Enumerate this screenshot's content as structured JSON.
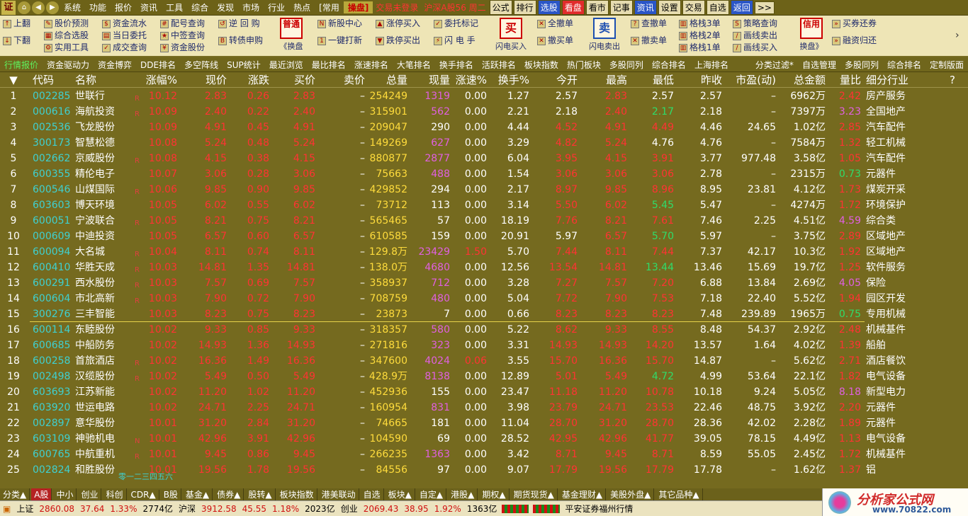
{
  "menubar": {
    "logo": "证",
    "items": [
      "系统",
      "功能",
      "报价",
      "资讯",
      "工具",
      "综合",
      "发现",
      "市场",
      "行业",
      "热点",
      "[常用"
    ],
    "hot_item": "操盘]",
    "status_login": "交易未登录",
    "status_index": "沪深A股56 周二",
    "right_buttons": [
      "公式",
      "排行",
      "选股",
      "看盘",
      "看市",
      "记事",
      "资讯",
      "设置",
      "交易",
      "自选",
      "返回",
      ">>"
    ]
  },
  "toolbar": {
    "col1": [
      "上翻",
      "下翻"
    ],
    "col2": [
      "股价预测",
      "综合选股",
      "实用工具"
    ],
    "col3": [
      "资金流水",
      "当日委托",
      "成交查询"
    ],
    "col4": [
      "配号查询",
      "中签查询",
      "资金股份"
    ],
    "col5": [
      "逆 回 购",
      "转债申购"
    ],
    "big_normal": {
      "top": "普通",
      "bottom": "《换盘"
    },
    "col6": [
      "新股中心",
      "一键打新"
    ],
    "col7": [
      "涨停买入",
      "跌停买出"
    ],
    "col8": [
      "委托标记",
      "闪 电 手"
    ],
    "big_buy": {
      "top": "买",
      "bottom": "闪电买入"
    },
    "col9": [
      "全撤单",
      "撤买单"
    ],
    "big_sell": {
      "top": "卖",
      "bottom": "闪电卖出"
    },
    "col10": [
      "查撤单",
      "撤卖单"
    ],
    "col11": [
      "格栈3单",
      "格栈2单",
      "格栈1单"
    ],
    "col12": [
      "策略查询",
      "画线卖出",
      "画线买入"
    ],
    "big_credit": {
      "top": "信用",
      "bottom": "换盘》"
    },
    "col13": [
      "买券还券",
      "融资归还"
    ]
  },
  "tabs2": [
    "行情报价",
    "资金驱动力",
    "资金博弈",
    "DDE排名",
    "多空阵线",
    "SUP统计",
    "最近浏览",
    "最比排名",
    "涨速排名",
    "大笔排名",
    "换手排名",
    "活跃排名",
    "板块指数",
    "热门板块",
    "多股同列",
    "综合排名",
    "上海排名",
    "",
    "分类过滤*",
    "自选管理",
    "多股同列",
    "综合排名",
    "定制版面"
  ],
  "table": {
    "headers": [
      "▼",
      "代码",
      "名称",
      "涨幅%",
      "现价",
      "涨跌",
      "买价",
      "卖价",
      "总量",
      "现量",
      "涨速%",
      "换手%",
      "今开",
      "最高",
      "最低",
      "昨收",
      "市盈(动)",
      "总金额",
      "量比",
      "细分行业"
    ],
    "rows": [
      {
        "seq": "1",
        "code": "002285",
        "name": "世联行",
        "mark": "R",
        "pct": "10.12",
        "price": "2.83",
        "chg": "0.26",
        "bid": "2.83",
        "ask": "–",
        "vol": "254249",
        "cur": "1319",
        "spd": "0.00",
        "turn": "1.27",
        "open": "2.57",
        "high": "2.83",
        "low": "2.57",
        "prev": "2.57",
        "pe": "–",
        "amt": "6962万",
        "ratio": "2.42",
        "ind": "房产服务"
      },
      {
        "seq": "2",
        "code": "000616",
        "name": "海航投资",
        "mark": "R",
        "pct": "10.09",
        "price": "2.40",
        "chg": "0.22",
        "bid": "2.40",
        "ask": "–",
        "vol": "315901",
        "cur": "562",
        "spd": "0.00",
        "turn": "2.21",
        "open": "2.18",
        "high": "2.40",
        "low": "2.17",
        "prev": "2.18",
        "pe": "–",
        "amt": "7397万",
        "ratio": "3.23",
        "ind": "全国地产"
      },
      {
        "seq": "3",
        "code": "002536",
        "name": "飞龙股份",
        "mark": "",
        "pct": "10.09",
        "price": "4.91",
        "chg": "0.45",
        "bid": "4.91",
        "ask": "–",
        "vol": "209047",
        "cur": "290",
        "spd": "0.00",
        "turn": "4.44",
        "open": "4.52",
        "high": "4.91",
        "low": "4.49",
        "prev": "4.46",
        "pe": "24.65",
        "amt": "1.02亿",
        "ratio": "2.85",
        "ind": "汽车配件"
      },
      {
        "seq": "4",
        "code": "300173",
        "name": "智慧松德",
        "mark": "",
        "pct": "10.08",
        "price": "5.24",
        "chg": "0.48",
        "bid": "5.24",
        "ask": "–",
        "vol": "149269",
        "cur": "627",
        "spd": "0.00",
        "turn": "3.29",
        "open": "4.82",
        "high": "5.24",
        "low": "4.76",
        "prev": "4.76",
        "pe": "–",
        "amt": "7584万",
        "ratio": "1.32",
        "ind": "轻工机械"
      },
      {
        "seq": "5",
        "code": "002662",
        "name": "京威股份",
        "mark": "R",
        "pct": "10.08",
        "price": "4.15",
        "chg": "0.38",
        "bid": "4.15",
        "ask": "–",
        "vol": "880877",
        "cur": "2877",
        "spd": "0.00",
        "turn": "6.04",
        "open": "3.95",
        "high": "4.15",
        "low": "3.91",
        "prev": "3.77",
        "pe": "977.48",
        "amt": "3.58亿",
        "ratio": "1.05",
        "ind": "汽车配件"
      },
      {
        "seq": "6",
        "code": "600355",
        "name": "精伦电子",
        "mark": "",
        "pct": "10.07",
        "price": "3.06",
        "chg": "0.28",
        "bid": "3.06",
        "ask": "–",
        "vol": "75663",
        "cur": "488",
        "spd": "0.00",
        "turn": "1.54",
        "open": "3.06",
        "high": "3.06",
        "low": "3.06",
        "prev": "2.78",
        "pe": "–",
        "amt": "2315万",
        "ratio": "0.73",
        "ind": "元器件"
      },
      {
        "seq": "7",
        "code": "600546",
        "name": "山煤国际",
        "mark": "R",
        "pct": "10.06",
        "price": "9.85",
        "chg": "0.90",
        "bid": "9.85",
        "ask": "–",
        "vol": "429852",
        "cur": "294",
        "spd": "0.00",
        "turn": "2.17",
        "open": "8.97",
        "high": "9.85",
        "low": "8.96",
        "prev": "8.95",
        "pe": "23.81",
        "amt": "4.12亿",
        "ratio": "1.73",
        "ind": "煤炭开采"
      },
      {
        "seq": "8",
        "code": "603603",
        "name": "博天环境",
        "mark": "",
        "pct": "10.05",
        "price": "6.02",
        "chg": "0.55",
        "bid": "6.02",
        "ask": "–",
        "vol": "73712",
        "cur": "113",
        "spd": "0.00",
        "turn": "3.14",
        "open": "5.50",
        "high": "6.02",
        "low": "5.45",
        "prev": "5.47",
        "pe": "–",
        "amt": "4274万",
        "ratio": "1.72",
        "ind": "环境保护"
      },
      {
        "seq": "9",
        "code": "600051",
        "name": "宁波联合",
        "mark": "R",
        "pct": "10.05",
        "price": "8.21",
        "chg": "0.75",
        "bid": "8.21",
        "ask": "–",
        "vol": "565465",
        "cur": "57",
        "spd": "0.00",
        "turn": "18.19",
        "open": "7.76",
        "high": "8.21",
        "low": "7.61",
        "prev": "7.46",
        "pe": "2.25",
        "amt": "4.51亿",
        "ratio": "4.59",
        "ind": "综合类"
      },
      {
        "seq": "10",
        "code": "000609",
        "name": "中迪投资",
        "mark": "",
        "pct": "10.05",
        "price": "6.57",
        "chg": "0.60",
        "bid": "6.57",
        "ask": "–",
        "vol": "610585",
        "cur": "159",
        "spd": "0.00",
        "turn": "20.91",
        "open": "5.97",
        "high": "6.57",
        "low": "5.70",
        "prev": "5.97",
        "pe": "–",
        "amt": "3.75亿",
        "ratio": "2.89",
        "ind": "区域地产"
      },
      {
        "seq": "11",
        "code": "600094",
        "name": "大名城",
        "mark": "R",
        "pct": "10.04",
        "price": "8.11",
        "chg": "0.74",
        "bid": "8.11",
        "ask": "–",
        "vol": "129.8万",
        "cur": "23429",
        "spd": "1.50",
        "turn": "5.70",
        "open": "7.44",
        "high": "8.11",
        "low": "7.44",
        "prev": "7.37",
        "pe": "42.17",
        "amt": "10.3亿",
        "ratio": "1.92",
        "ind": "区域地产"
      },
      {
        "seq": "12",
        "code": "600410",
        "name": "华胜天成",
        "mark": "R",
        "pct": "10.03",
        "price": "14.81",
        "chg": "1.35",
        "bid": "14.81",
        "ask": "–",
        "vol": "138.0万",
        "cur": "4680",
        "spd": "0.00",
        "turn": "12.56",
        "open": "13.54",
        "high": "14.81",
        "low": "13.44",
        "prev": "13.46",
        "pe": "15.69",
        "amt": "19.7亿",
        "ratio": "1.25",
        "ind": "软件服务"
      },
      {
        "seq": "13",
        "code": "600291",
        "name": "西水股份",
        "mark": "R",
        "pct": "10.03",
        "price": "7.57",
        "chg": "0.69",
        "bid": "7.57",
        "ask": "–",
        "vol": "358937",
        "cur": "712",
        "spd": "0.00",
        "turn": "3.28",
        "open": "7.27",
        "high": "7.57",
        "low": "7.20",
        "prev": "6.88",
        "pe": "13.84",
        "amt": "2.69亿",
        "ratio": "4.05",
        "ind": "保险"
      },
      {
        "seq": "14",
        "code": "600604",
        "name": "市北高新",
        "mark": "R",
        "pct": "10.03",
        "price": "7.90",
        "chg": "0.72",
        "bid": "7.90",
        "ask": "–",
        "vol": "708759",
        "cur": "480",
        "spd": "0.00",
        "turn": "5.04",
        "open": "7.72",
        "high": "7.90",
        "low": "7.53",
        "prev": "7.18",
        "pe": "22.40",
        "amt": "5.52亿",
        "ratio": "1.94",
        "ind": "园区开发"
      },
      {
        "seq": "15",
        "code": "300276",
        "name": "三丰智能",
        "mark": "",
        "pct": "10.03",
        "price": "8.23",
        "chg": "0.75",
        "bid": "8.23",
        "ask": "–",
        "vol": "23873",
        "cur": "7",
        "spd": "0.00",
        "turn": "0.66",
        "open": "8.23",
        "high": "8.23",
        "low": "8.23",
        "prev": "7.48",
        "pe": "239.89",
        "amt": "1965万",
        "ratio": "0.75",
        "ind": "专用机械"
      },
      {
        "seq": "16",
        "code": "600114",
        "name": "东睦股份",
        "mark": "",
        "pct": "10.02",
        "price": "9.33",
        "chg": "0.85",
        "bid": "9.33",
        "ask": "–",
        "vol": "318357",
        "cur": "580",
        "spd": "0.00",
        "turn": "5.22",
        "open": "8.62",
        "high": "9.33",
        "low": "8.55",
        "prev": "8.48",
        "pe": "54.37",
        "amt": "2.92亿",
        "ratio": "2.48",
        "ind": "机械基件"
      },
      {
        "seq": "17",
        "code": "600685",
        "name": "中船防务",
        "mark": "",
        "pct": "10.02",
        "price": "14.93",
        "chg": "1.36",
        "bid": "14.93",
        "ask": "–",
        "vol": "271816",
        "cur": "323",
        "spd": "0.00",
        "turn": "3.31",
        "open": "14.93",
        "high": "14.93",
        "low": "14.20",
        "prev": "13.57",
        "pe": "1.64",
        "amt": "4.02亿",
        "ratio": "1.39",
        "ind": "船舶"
      },
      {
        "seq": "18",
        "code": "600258",
        "name": "首旅酒店",
        "mark": "R",
        "pct": "10.02",
        "price": "16.36",
        "chg": "1.49",
        "bid": "16.36",
        "ask": "–",
        "vol": "347600",
        "cur": "4024",
        "spd": "0.06",
        "turn": "3.55",
        "open": "15.70",
        "high": "16.36",
        "low": "15.70",
        "prev": "14.87",
        "pe": "–",
        "amt": "5.62亿",
        "ratio": "2.71",
        "ind": "酒店餐饮"
      },
      {
        "seq": "19",
        "code": "002498",
        "name": "汉缆股份",
        "mark": "R",
        "pct": "10.02",
        "price": "5.49",
        "chg": "0.50",
        "bid": "5.49",
        "ask": "–",
        "vol": "428.9万",
        "cur": "8138",
        "spd": "0.00",
        "turn": "12.89",
        "open": "5.01",
        "high": "5.49",
        "low": "4.72",
        "prev": "4.99",
        "pe": "53.64",
        "amt": "22.1亿",
        "ratio": "1.82",
        "ind": "电气设备"
      },
      {
        "seq": "20",
        "code": "603693",
        "name": "江苏新能",
        "mark": "",
        "pct": "10.02",
        "price": "11.20",
        "chg": "1.02",
        "bid": "11.20",
        "ask": "–",
        "vol": "452936",
        "cur": "155",
        "spd": "0.00",
        "turn": "23.47",
        "open": "11.18",
        "high": "11.20",
        "low": "10.78",
        "prev": "10.18",
        "pe": "9.24",
        "amt": "5.05亿",
        "ratio": "8.18",
        "ind": "新型电力"
      },
      {
        "seq": "21",
        "code": "603920",
        "name": "世运电路",
        "mark": "",
        "pct": "10.02",
        "price": "24.71",
        "chg": "2.25",
        "bid": "24.71",
        "ask": "–",
        "vol": "160954",
        "cur": "831",
        "spd": "0.00",
        "turn": "3.98",
        "open": "23.79",
        "high": "24.71",
        "low": "23.53",
        "prev": "22.46",
        "pe": "48.75",
        "amt": "3.92亿",
        "ratio": "2.20",
        "ind": "元器件"
      },
      {
        "seq": "22",
        "code": "002897",
        "name": "意华股份",
        "mark": "",
        "pct": "10.01",
        "price": "31.20",
        "chg": "2.84",
        "bid": "31.20",
        "ask": "–",
        "vol": "74665",
        "cur": "181",
        "spd": "0.00",
        "turn": "11.04",
        "open": "28.70",
        "high": "31.20",
        "low": "28.70",
        "prev": "28.36",
        "pe": "42.02",
        "amt": "2.28亿",
        "ratio": "1.89",
        "ind": "元器件"
      },
      {
        "seq": "23",
        "code": "603109",
        "name": "神驰机电",
        "mark": "N",
        "pct": "10.01",
        "price": "42.96",
        "chg": "3.91",
        "bid": "42.96",
        "ask": "–",
        "vol": "104590",
        "cur": "69",
        "spd": "0.00",
        "turn": "28.52",
        "open": "42.95",
        "high": "42.96",
        "low": "41.77",
        "prev": "39.05",
        "pe": "78.15",
        "amt": "4.49亿",
        "ratio": "1.13",
        "ind": "电气设备"
      },
      {
        "seq": "24",
        "code": "600765",
        "name": "中航重机",
        "mark": "R",
        "pct": "10.01",
        "price": "9.45",
        "chg": "0.86",
        "bid": "9.45",
        "ask": "–",
        "vol": "266235",
        "cur": "1363",
        "spd": "0.00",
        "turn": "3.42",
        "open": "8.71",
        "high": "9.45",
        "low": "8.71",
        "prev": "8.59",
        "pe": "55.05",
        "amt": "2.45亿",
        "ratio": "1.72",
        "ind": "机械基件"
      },
      {
        "seq": "25",
        "code": "002824",
        "name": "和胜股份",
        "mark": "",
        "pct": "10.01",
        "price": "19.56",
        "chg": "1.78",
        "bid": "19.56",
        "ask": "–",
        "vol": "84556",
        "cur": "97",
        "spd": "0.00",
        "turn": "9.07",
        "open": "17.79",
        "high": "19.56",
        "low": "17.79",
        "prev": "17.78",
        "pe": "–",
        "amt": "1.62亿",
        "ratio": "1.37",
        "ind": "铝"
      }
    ]
  },
  "float_label": "零一二三四五六",
  "bottom_tabs": [
    "分类▲",
    "A股",
    "中小",
    "创业",
    "科创",
    "CDR▲",
    "B股",
    "基金▲",
    "债券▲",
    "股转▲",
    "板块指数",
    "港美联动",
    "自选",
    "板块▲",
    "自定▲",
    "港股▲",
    "期权▲",
    "期货现货▲",
    "基金理财▲",
    "美股外盘▲",
    "其它品种▲"
  ],
  "statusbar": {
    "sh_label": "上证",
    "sh_value": "2860.08",
    "sh_chg": "37.64",
    "sh_pct": "1.33%",
    "sh_amt": "2774亿",
    "hs_label": "沪深",
    "hs_value": "3912.58",
    "hs_chg": "45.55",
    "hs_pct": "1.18%",
    "hs_amt": "2023亿",
    "cy_label": "创业",
    "cy_value": "2069.43",
    "cy_chg": "38.95",
    "cy_pct": "1.92%",
    "cy_amt": "1363亿",
    "broker": "平安证券福州行情"
  },
  "brand": {
    "title": "分析家公式网",
    "url": "www.70822.com"
  },
  "colors": {
    "up": "#ff3333",
    "down": "#2fdc6a",
    "code": "#3fd0d0",
    "volume": "#ffdc3c",
    "magenta": "#e060e0",
    "bg": "#756a1f"
  }
}
